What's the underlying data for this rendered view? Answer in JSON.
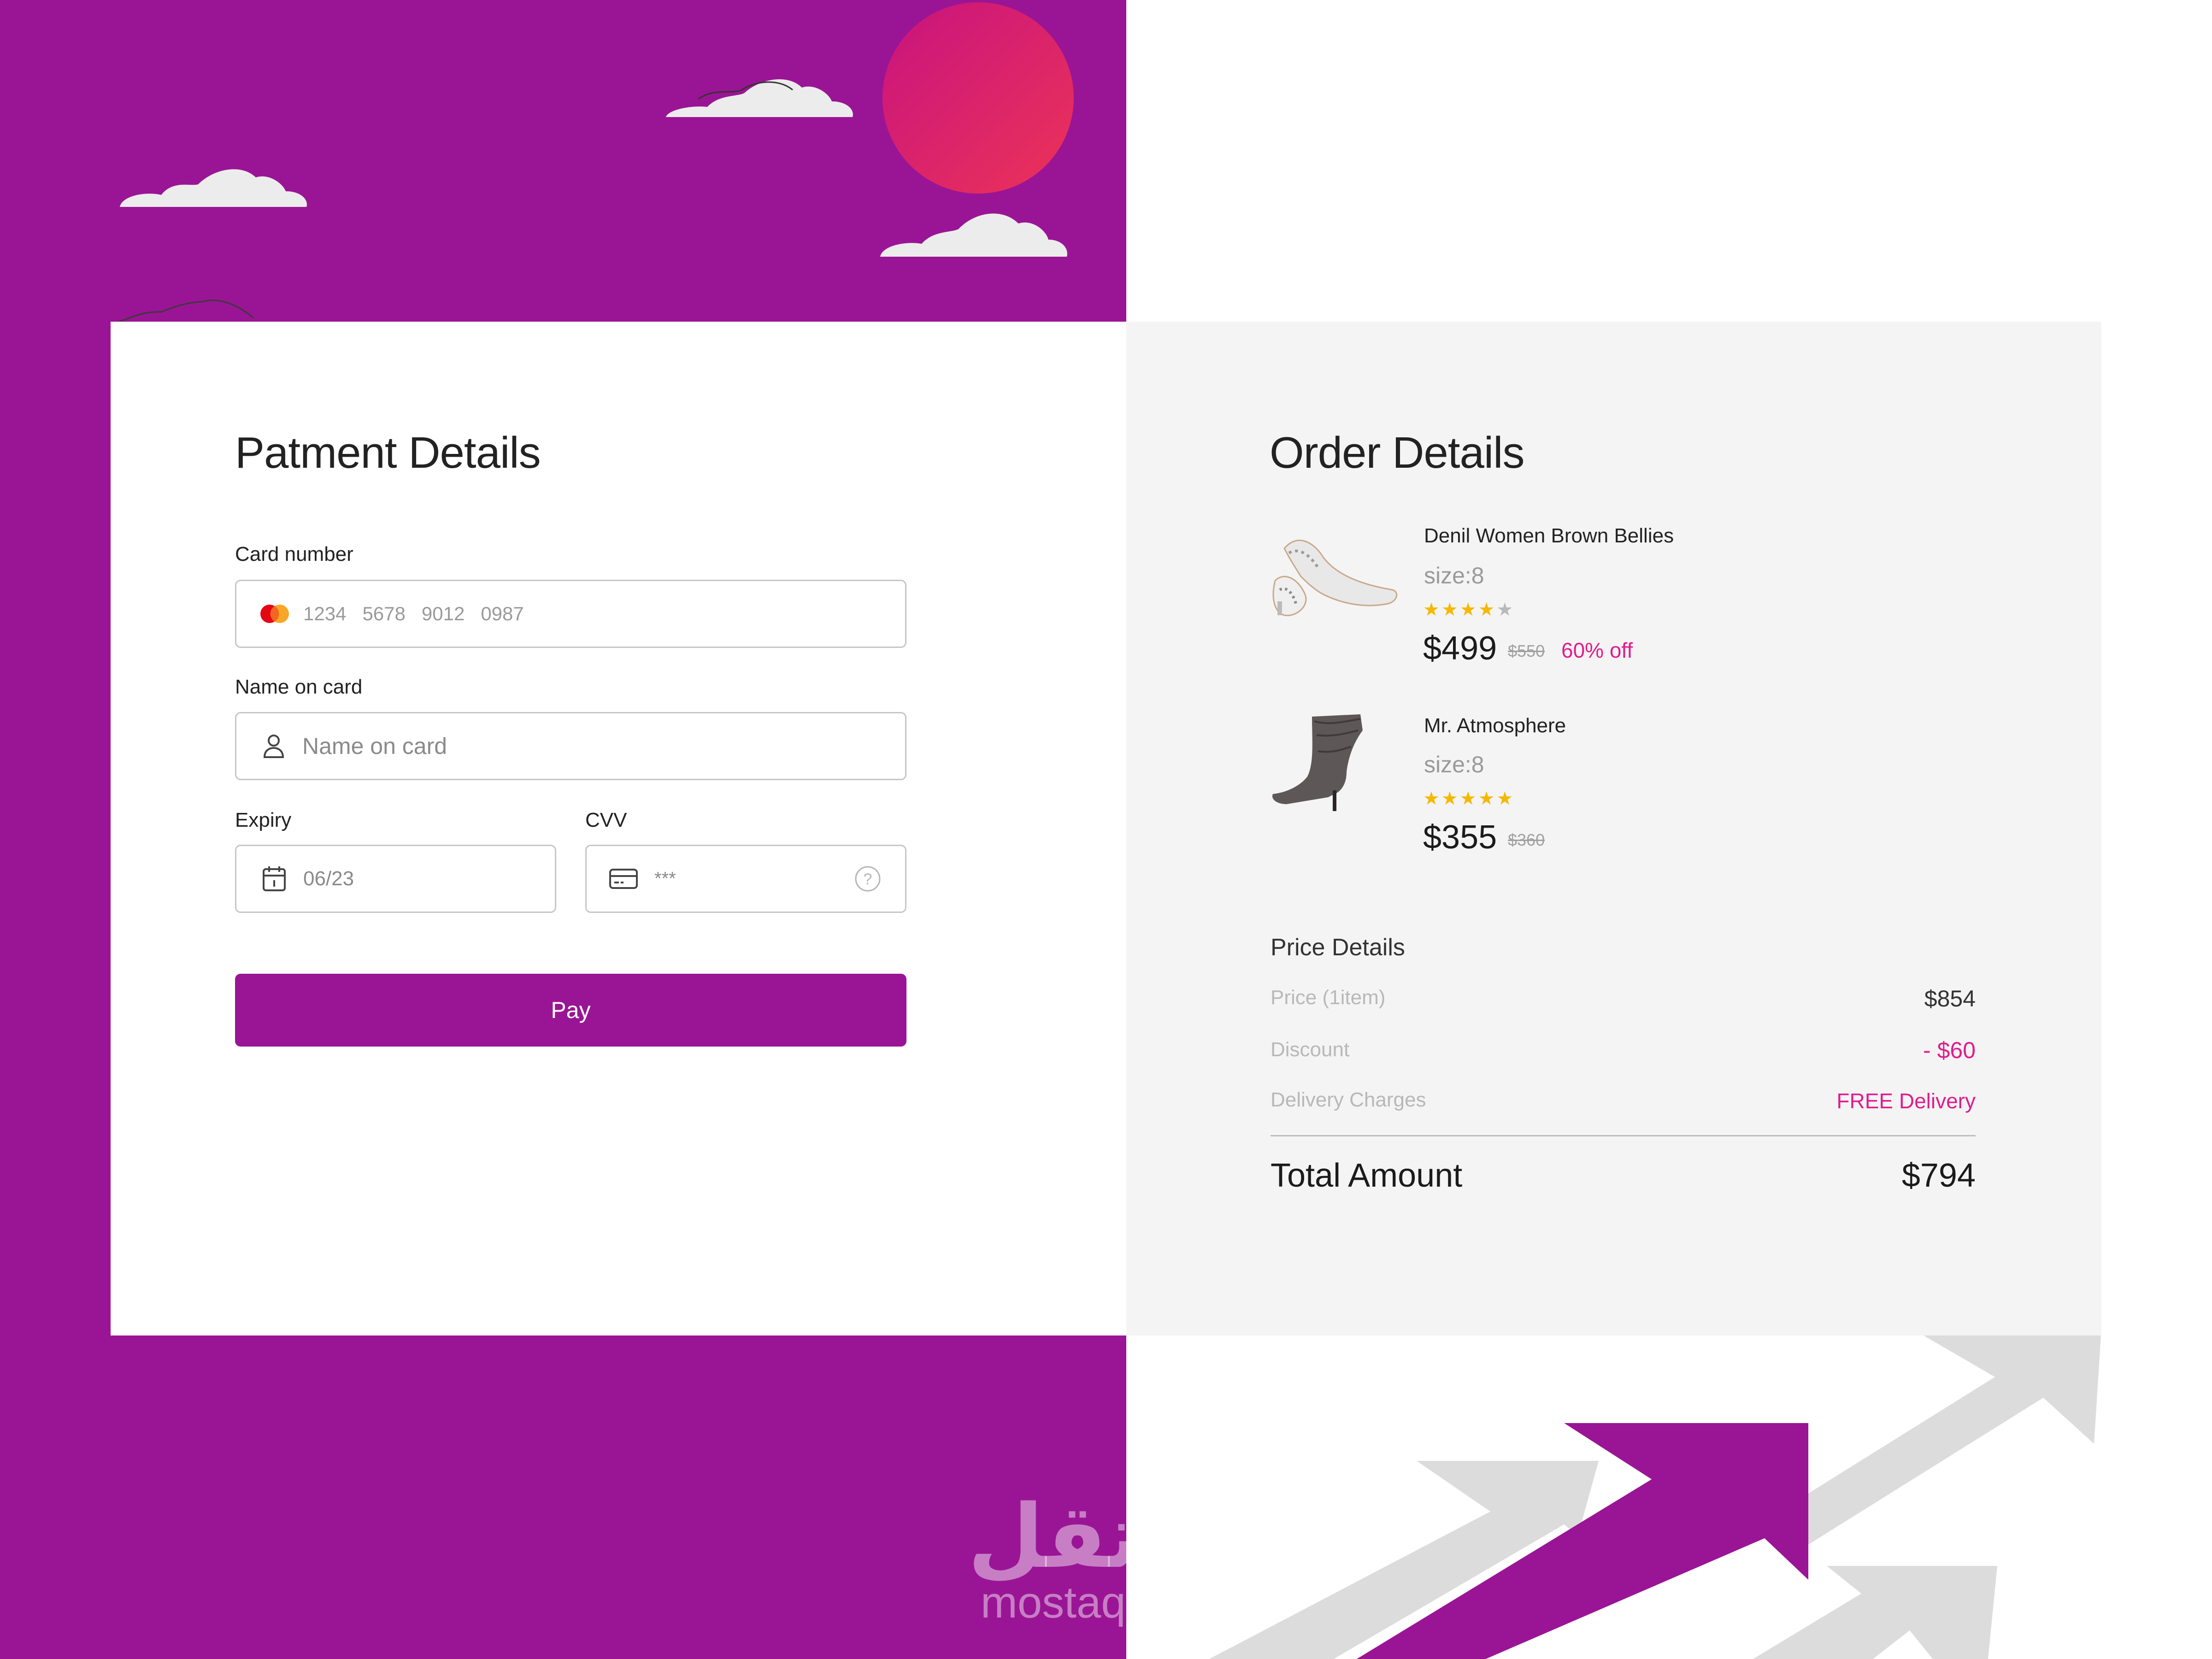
{
  "payment": {
    "title": "Patment Details",
    "card_number_label": "Card number",
    "card_number_placeholder": "1234   5678   9012   0987",
    "name_label": "Name on card",
    "name_placeholder": "Name on card",
    "expiry_label": "Expiry",
    "expiry_value": "06/23",
    "cvv_label": "CVV",
    "cvv_value": "***",
    "pay_label": "Pay"
  },
  "order": {
    "title": "Order Details",
    "items": [
      {
        "name": "Denil Women Brown Bellies",
        "size": "size:8",
        "rating": 4,
        "price": "$499",
        "old_price": "$550",
        "discount": "60% off"
      },
      {
        "name": "Mr. Atmosphere",
        "size": "size:8",
        "rating": 5,
        "price": "$355",
        "old_price": "$360",
        "discount": ""
      }
    ],
    "price_details": {
      "title": "Price Details",
      "rows": [
        {
          "label": "Price (1item)",
          "value": "$854"
        },
        {
          "label": "Discount",
          "value": "- $60"
        },
        {
          "label": "Delivery Charges",
          "value": "FREE Delivery"
        }
      ],
      "total_label": "Total Amount",
      "total_value": "$794"
    }
  },
  "watermark": {
    "arabic": "مستقل",
    "latin": "mostaql.com"
  },
  "colors": {
    "brand": "#9a1595",
    "accent": "#e01c8d",
    "star": "#f5b800"
  },
  "icons": [
    "mastercard-icon",
    "user-icon",
    "calendar-icon",
    "card-icon",
    "help-icon",
    "star-icon"
  ]
}
